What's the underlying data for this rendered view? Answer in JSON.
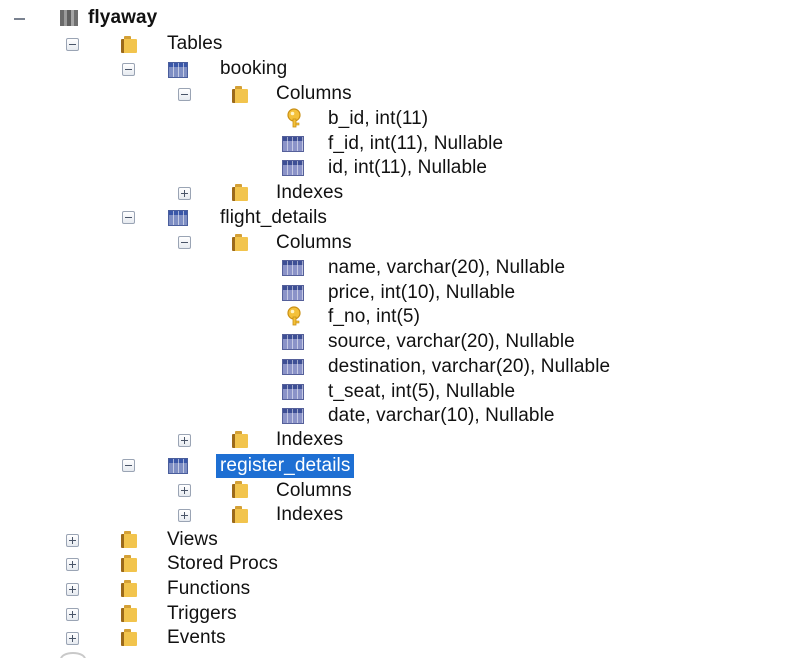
{
  "tree": {
    "root": "flyaway",
    "tables_label": "Tables",
    "booking": {
      "name": "booking",
      "columns_label": "Columns",
      "columns": [
        "b_id, int(11)",
        "f_id, int(11), Nullable",
        "id, int(11), Nullable"
      ],
      "indexes_label": "Indexes"
    },
    "flight_details": {
      "name": "flight_details",
      "columns_label": "Columns",
      "columns": [
        "name, varchar(20), Nullable",
        "price, int(10), Nullable",
        "f_no, int(5)",
        "source, varchar(20), Nullable",
        "destination, varchar(20), Nullable",
        "t_seat, int(5), Nullable",
        "date, varchar(10), Nullable"
      ],
      "indexes_label": "Indexes"
    },
    "register_details": {
      "name": "register_details",
      "columns_label": "Columns",
      "indexes_label": "Indexes"
    },
    "views_label": "Views",
    "stored_procs_label": "Stored Procs",
    "functions_label": "Functions",
    "triggers_label": "Triggers",
    "events_label": "Events"
  },
  "icons": {
    "database": "database-icon",
    "folder": "folder-icon",
    "table": "table-icon",
    "column": "column-icon",
    "primary_key": "key-icon"
  },
  "colors": {
    "selection": "#1e6fd3",
    "folder": "#f2c44d",
    "table": "#3a57a8",
    "key": "#f0b429"
  }
}
